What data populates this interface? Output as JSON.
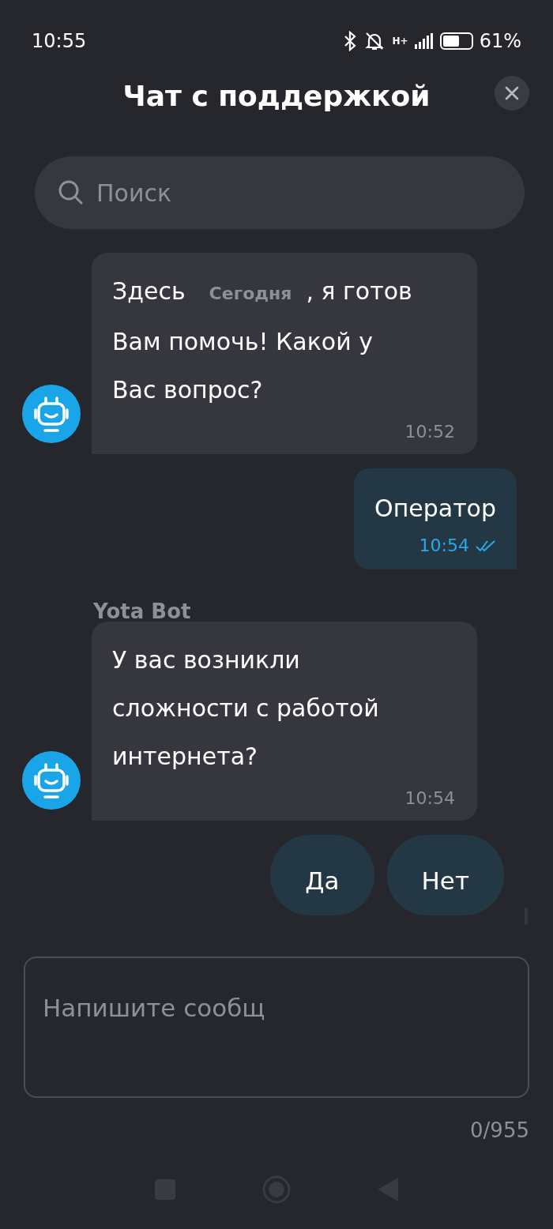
{
  "status_bar": {
    "time": "10:55",
    "battery_percent": "61%",
    "network": "H+"
  },
  "header": {
    "title": "Чат с поддержкой"
  },
  "search": {
    "placeholder": "Поиск"
  },
  "messages": [
    {
      "kind": "bot",
      "text_before": "Здесь",
      "date_label": "Сегодня",
      "text_after": ", я готов",
      "text_rest": "Вам помочь! Какой у Вас вопрос?",
      "time": "10:52"
    },
    {
      "kind": "user",
      "text": "Оператор",
      "time": "10:54",
      "read": true
    },
    {
      "kind": "bot",
      "sender": "Yota Bot",
      "text": "У вас возникли сложности с работой интернета?",
      "time": "10:54"
    }
  ],
  "quick_replies": [
    "Да",
    "Нет"
  ],
  "composer": {
    "placeholder": "Напишите сообщ",
    "counter": "0/955"
  }
}
